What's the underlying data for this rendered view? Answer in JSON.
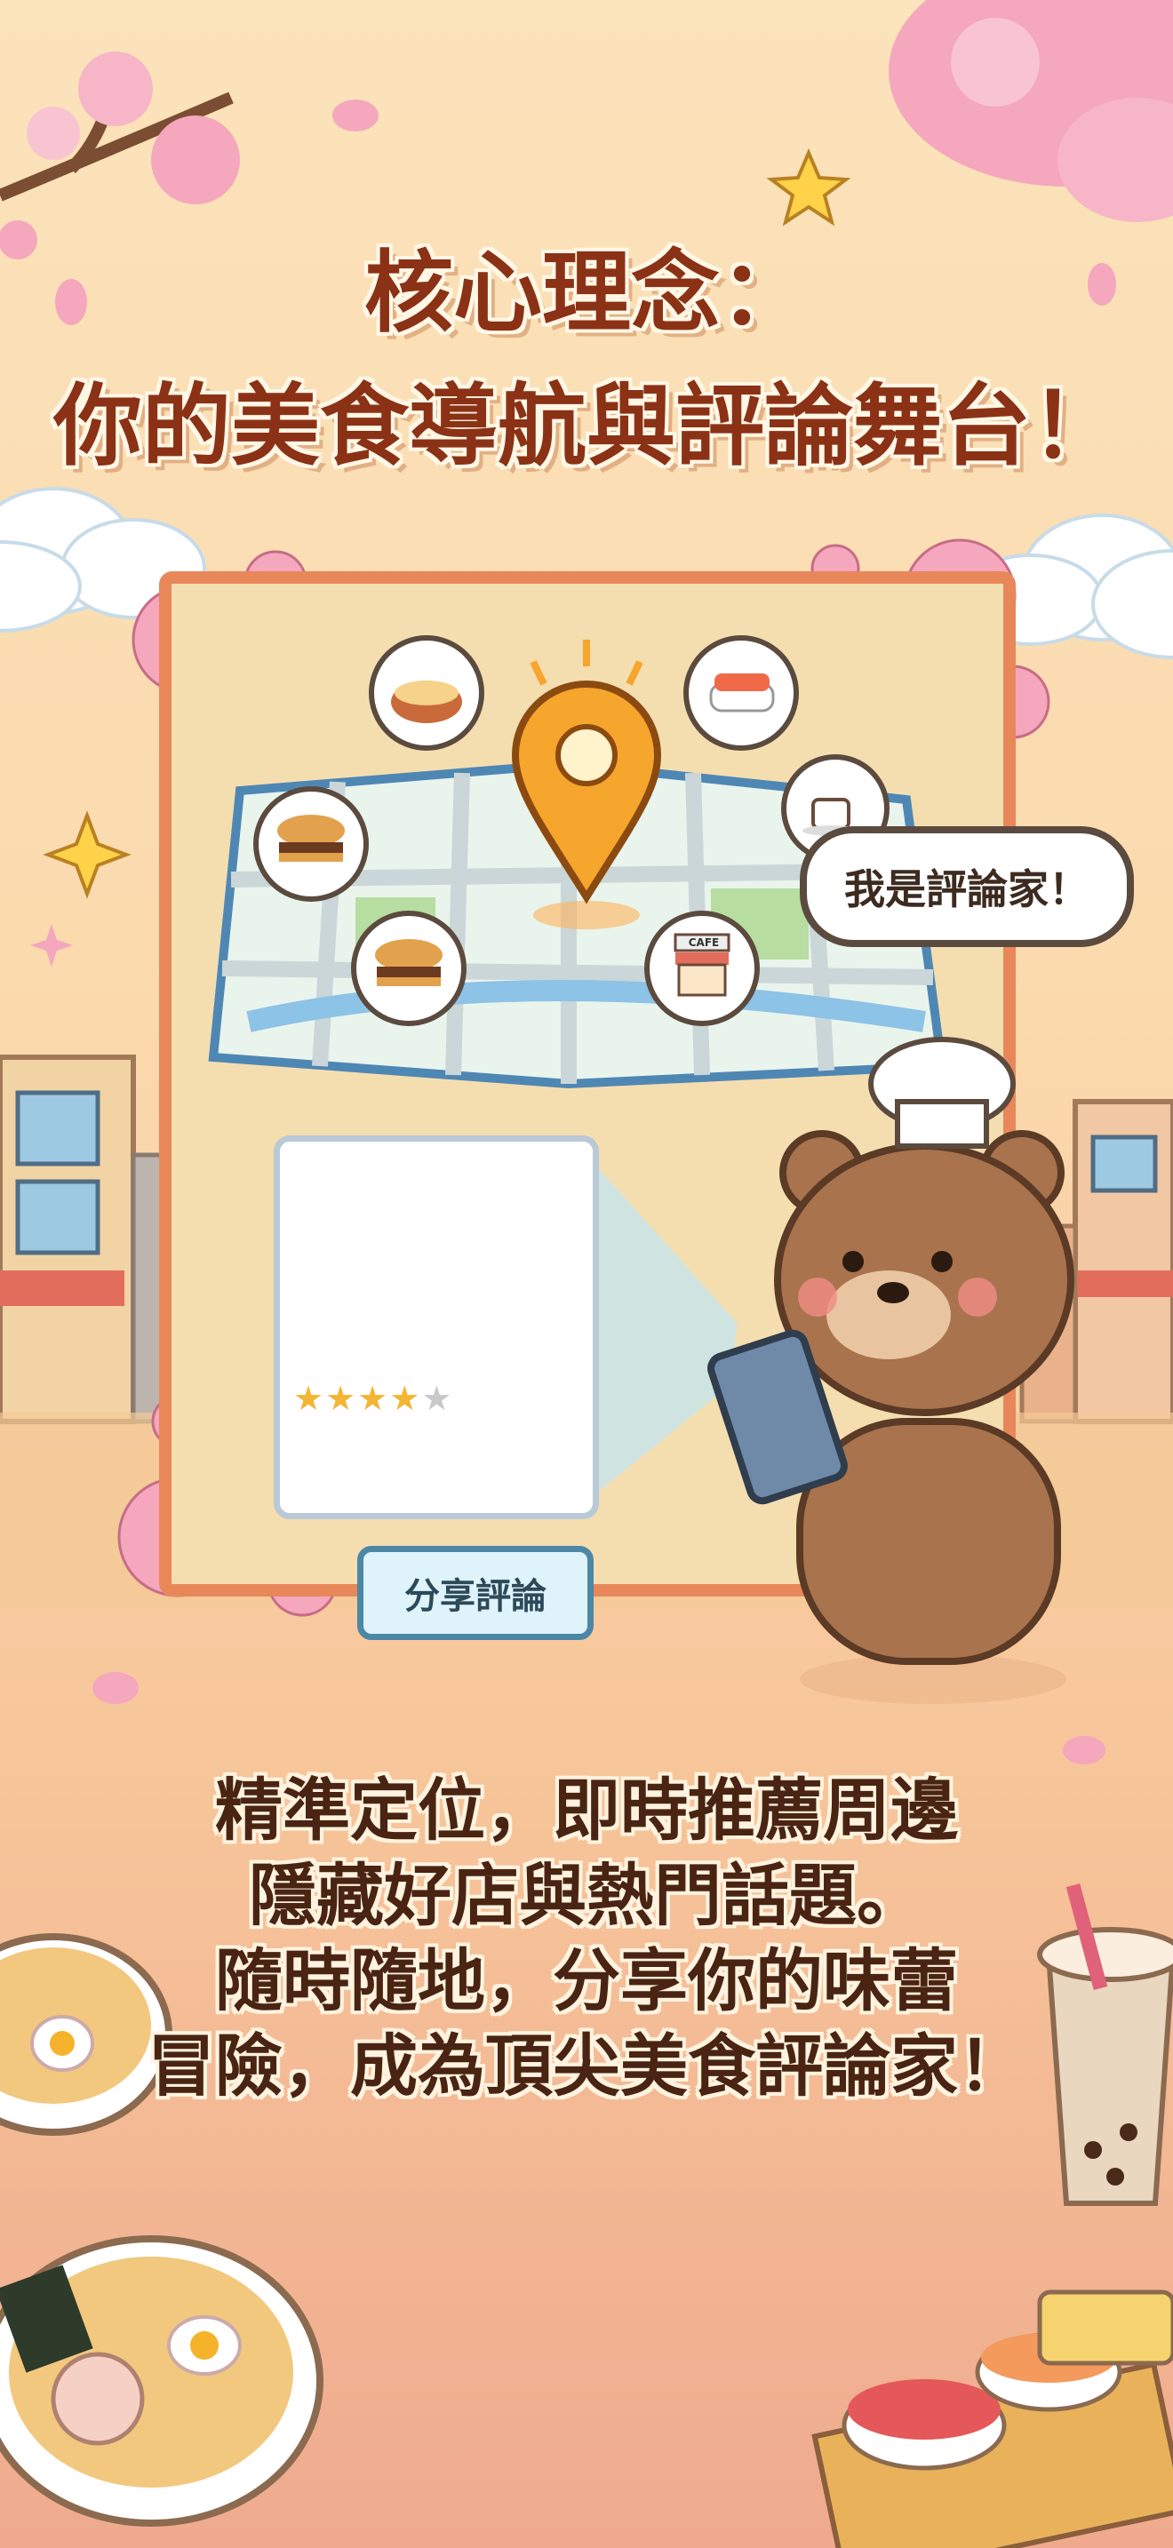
{
  "title": {
    "line1": "核心理念：",
    "line2": "你的美食導航與評論舞台！"
  },
  "speech_bubble": "我是評論家！",
  "share_tag": "分享評論",
  "cafe_sign": "CAFE",
  "review_card": {
    "rating": 4,
    "max_rating": 5
  },
  "body": {
    "line1": "精準定位，即時推薦周邊",
    "line2": "隱藏好店與熱門話題。",
    "line3": "隨時隨地，分享你的味蕾",
    "line4": "冒險，成為頂尖美食評論家！"
  },
  "icons": [
    "sakura-icon",
    "star-icon",
    "map-pin-icon",
    "ramen-icon",
    "sushi-icon",
    "burger-icon",
    "coffee-icon",
    "cafe-icon",
    "bear-chef-icon",
    "phone-icon",
    "bubble-tea-icon"
  ]
}
